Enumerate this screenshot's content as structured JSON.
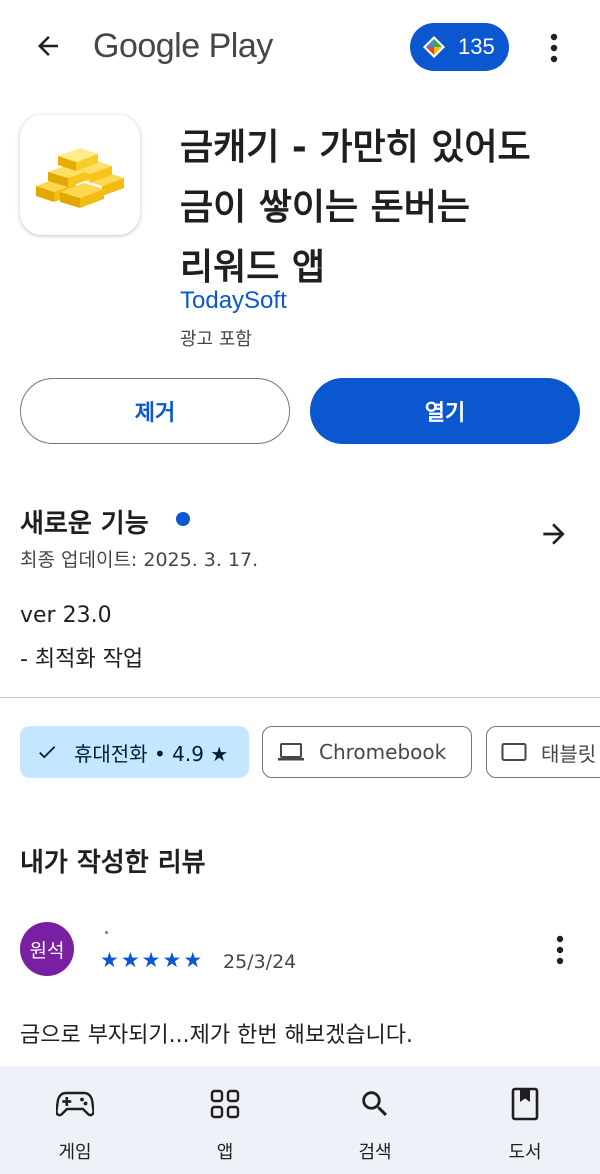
{
  "header": {
    "logo_text": "Google Play",
    "points_count": "135"
  },
  "app": {
    "title_lines": [
      "금캐기 - 가만히 있어도",
      "금이 쌓이는 돈버는",
      "리워드 앱"
    ],
    "developer": "TodaySoft",
    "ads_note": "광고 포함",
    "remove_label": "제거",
    "open_label": "열기"
  },
  "whats_new": {
    "title": "새로운 기능",
    "updated": "최종 업데이트: 2025. 3. 17.",
    "version": "ver 23.0",
    "changelog": "- 최적화 작업"
  },
  "devices": {
    "phone": "휴대전화 • 4.9 ★",
    "chromebook": "Chromebook",
    "tablet": "태블릿"
  },
  "review": {
    "heading": "내가 작성한 리뷰",
    "avatar_text": "원석",
    "rating": 5,
    "date": "25/3/24",
    "text": "금으로 부자되기...제가 한번 해보겠습니다."
  },
  "bottom_nav": {
    "items": [
      {
        "label": "게임",
        "icon": "gamepad-icon"
      },
      {
        "label": "앱",
        "icon": "apps-grid-icon"
      },
      {
        "label": "검색",
        "icon": "search-icon"
      },
      {
        "label": "도서",
        "icon": "book-icon"
      }
    ]
  },
  "colors": {
    "accent": "#0b57d0",
    "chip_selected_bg": "#c2e7ff",
    "avatar_bg": "#7b1fa2",
    "nav_bg": "#eef2f8"
  }
}
